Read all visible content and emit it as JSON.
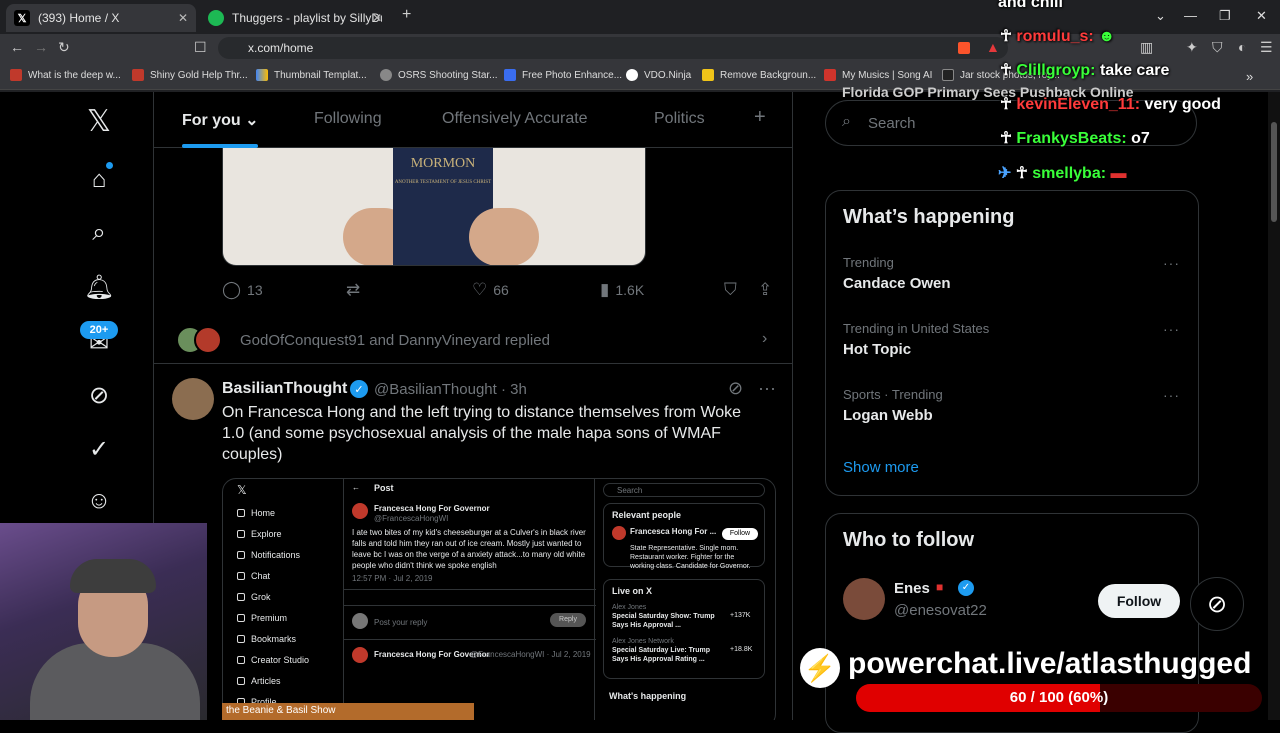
{
  "browser": {
    "tabs": [
      {
        "title": "(393) Home / X",
        "active": true
      },
      {
        "title": "Thuggers - playlist by SillyDuckSt...",
        "active": false
      }
    ],
    "url": "x.com/home",
    "bookmarks": [
      "What is the deep w...",
      "Shiny Gold Help Thr...",
      "Thumbnail Templat...",
      "OSRS Shooting Star...",
      "Free Photo Enhance...",
      "VDO.Ninja",
      "Remove Backgroun...",
      "My Musics | Song AI",
      "Jar stock photos, roy..."
    ]
  },
  "feed_tabs": {
    "for_you": "For you",
    "following": "Following",
    "offensively": "Offensively Accurate",
    "politics": "Politics",
    "add": "+"
  },
  "badge": "20+",
  "post1": {
    "book_title": "MORMON",
    "book_sub": "ANOTHER TESTAMENT OF JESUS CHRIST",
    "replies": "13",
    "likes": "66",
    "views": "1.6K"
  },
  "replied": {
    "text": "GodOfConquest91 and DannyVineyard replied"
  },
  "post2": {
    "name": "BasilianThought",
    "handle": "@BasilianThought · 3h",
    "text": "On Francesca Hong and the left trying to distance themselves from Woke 1.0 (and some psychosexual analysis of the male hapa sons of WMAF couples)"
  },
  "embed": {
    "sidebar": [
      "Home",
      "Explore",
      "Notifications",
      "Chat",
      "Grok",
      "Premium",
      "Bookmarks",
      "Creator Studio",
      "Articles",
      "Profile"
    ],
    "post_header": "Post",
    "author": "Francesca Hong For Governor",
    "author_handle": "@FrancescaHongWI",
    "body": "I ate two bites of my kid's cheeseburger at a Culver's in black river falls and told him they ran out of ice cream. Mostly just wanted to leave bc I was on the verge of a anxiety attack...to many old white people who didn't think we spoke english",
    "time": "12:57 PM · Jul 2, 2019",
    "reply_placeholder": "Post your reply",
    "reply_btn": "Reply",
    "second_author": "Francesca Hong For Governor",
    "second_meta": "@FrancescaHongWI · Jul 2, 2019",
    "search": "Search",
    "relevant_people": "Relevant people",
    "rp_bio": "State Representative. Single mom. Restaurant worker. Fighter for the working class. Candidate for Governor.",
    "follow": "Follow",
    "live_on_x": "Live on X",
    "live1_host": "Alex Jones",
    "live1_title": "Special Saturday Show: Trump Says His Approval ...",
    "live1_count": "+137K",
    "live2_host": "Alex Jones Network",
    "live2_title": "Special Saturday Live: Trump Says His Approval Rating ...",
    "live2_count": "+18.8K",
    "whats_happening": "What's happening"
  },
  "right": {
    "overhead": "Florida GOP Primary Sees Pushback Online",
    "search_placeholder": "Search",
    "happening_title": "What’s happening",
    "trends": [
      {
        "meta": "Trending",
        "name": "Candace Owen"
      },
      {
        "meta": "Trending in United States",
        "name": "Hot Topic"
      },
      {
        "meta": "Sports · Trending",
        "name": "Logan Webb"
      }
    ],
    "show_more": "Show more",
    "wtf_title": "Who to follow",
    "wtf_name": "Enes",
    "wtf_handle": "@enesovat22",
    "follow": "Follow"
  },
  "chat": [
    {
      "user": "",
      "msg": "and chill",
      "color": "#ffffff"
    },
    {
      "user": "romulu_s:",
      "msg": "",
      "color": "#ff3b3b"
    },
    {
      "user": "Clillgroyp:",
      "msg": "take care",
      "color": "#39ff39"
    },
    {
      "user": "kevinEleven_11:",
      "msg": "very good",
      "color": "#ff3b3b"
    },
    {
      "user": "FrankysBeats:",
      "msg": "o7",
      "color": "#39ff39"
    },
    {
      "user": "smellyba:",
      "msg": "",
      "color": "#39ff39"
    }
  ],
  "stream": {
    "lower_third": "the Beanie & Basil Show",
    "powerchat": "powerchat.live/atlasthugged",
    "goal_label": "60 / 100 (60%)",
    "goal_fraction": 0.6
  }
}
